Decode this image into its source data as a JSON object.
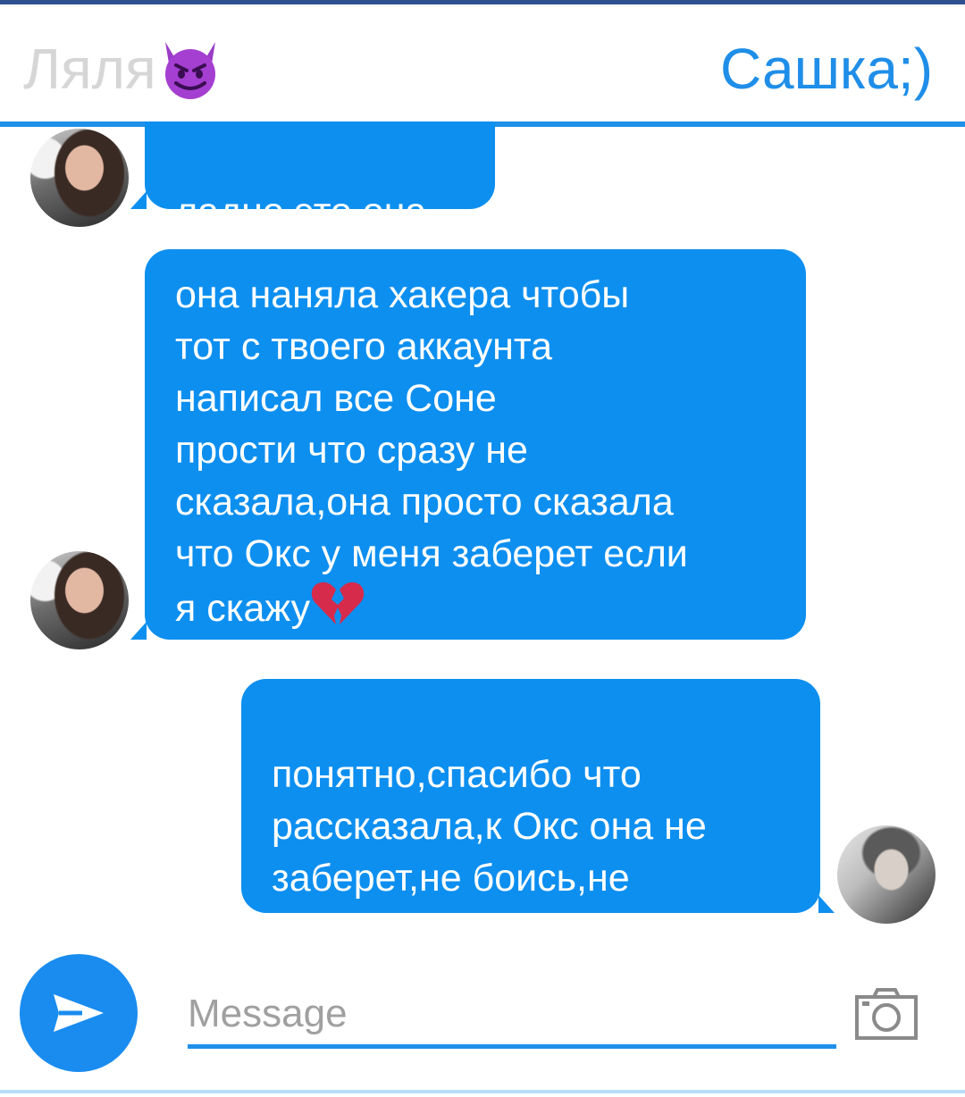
{
  "header": {
    "contact_name": "Ляля",
    "contact_emoji_icon": "smiling-devil-icon",
    "user_name": "Сашка;)"
  },
  "messages": [
    {
      "sender": "Ляля",
      "side": "left",
      "text": "ладно,это она"
    },
    {
      "sender": "Ляля",
      "side": "left",
      "text": "она наняла хакера чтобы\nтот с твоего аккаунта\nнаписал все Соне\nпрости что сразу не\nсказала,она просто сказала\nчто Окс у меня заберет если\nя скажу",
      "trailing_emoji_icon": "broken-heart-icon"
    },
    {
      "sender": "Сашка;)",
      "side": "right",
      "text": "понятно,спасибо что\nрассказала,к Окс она не\nзаберет,не боись,не\nотдадим"
    }
  ],
  "composer": {
    "placeholder": "Message",
    "send_icon": "send-icon",
    "camera_icon": "camera-icon"
  },
  "colors": {
    "accent": "#1e90ea",
    "bubble": "#0d8ff0",
    "contact_name": "#d6d6d6",
    "user_name": "#1f8ee8",
    "top_strip": "#2f4f8f"
  }
}
